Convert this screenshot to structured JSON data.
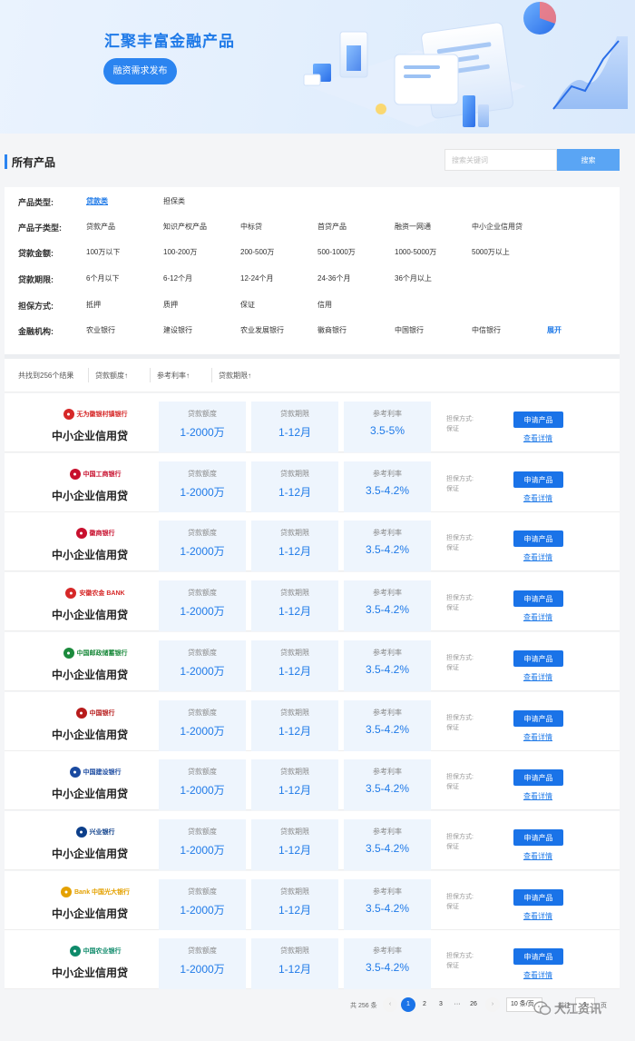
{
  "banner": {
    "title": "汇聚丰富金融产品",
    "button_label": "融资需求发布"
  },
  "section": {
    "title": "所有产品",
    "search_placeholder": "搜索关键词",
    "search_button": "搜索"
  },
  "filters": {
    "rows": [
      {
        "label": "产品类型:",
        "options": [
          "贷款类",
          "担保类"
        ],
        "active": 0
      },
      {
        "label": "产品子类型:",
        "options": [
          "贷款产品",
          "知识产权产品",
          "中标贷",
          "首贷产品",
          "融资一网通",
          "中小企业信用贷"
        ],
        "active": -1
      },
      {
        "label": "贷款金额:",
        "options": [
          "100万以下",
          "100-200万",
          "200-500万",
          "500-1000万",
          "1000-5000万",
          "5000万以上"
        ],
        "active": -1
      },
      {
        "label": "贷款期限:",
        "options": [
          "6个月以下",
          "6-12个月",
          "12-24个月",
          "24-36个月",
          "36个月以上"
        ],
        "active": -1
      },
      {
        "label": "担保方式:",
        "options": [
          "抵押",
          "质押",
          "保证",
          "信用"
        ],
        "active": -1
      },
      {
        "label": "金融机构:",
        "options": [
          "农业银行",
          "建设银行",
          "农业发展银行",
          "徽商银行",
          "中国银行",
          "中信银行"
        ],
        "active": -1
      }
    ],
    "expand_label": "展开"
  },
  "sortbar": {
    "result_text": "共找到256个结果",
    "sorts": [
      "贷款额度↑",
      "参考利率↑",
      "贷款期限↑"
    ]
  },
  "product_labels": {
    "amount": "贷款额度",
    "term": "贷款期限",
    "rate": "参考利率",
    "guarantee_label": "担保方式:",
    "apply": "申请产品",
    "detail": "查看详情"
  },
  "products": [
    {
      "bank": "无为徽银村镇银行",
      "logo_color": "#d62828",
      "icon": "bank-logo-icon",
      "name": "中小企业信用贷",
      "amount": "1-2000万",
      "term": "1-12月",
      "rate": "3.5-5%",
      "guarantee": "保证"
    },
    {
      "bank": "中国工商银行",
      "logo_color": "#c8102e",
      "icon": "bank-logo-icon",
      "name": "中小企业信用贷",
      "amount": "1-2000万",
      "term": "1-12月",
      "rate": "3.5-4.2%",
      "guarantee": "保证"
    },
    {
      "bank": "徽商银行",
      "logo_color": "#c8102e",
      "icon": "bank-logo-icon",
      "name": "中小企业信用贷",
      "amount": "1-2000万",
      "term": "1-12月",
      "rate": "3.5-4.2%",
      "guarantee": "保证"
    },
    {
      "bank": "安徽农金 BANK",
      "logo_color": "#d62828",
      "icon": "bank-logo-icon",
      "name": "中小企业信用贷",
      "amount": "1-2000万",
      "term": "1-12月",
      "rate": "3.5-4.2%",
      "guarantee": "保证"
    },
    {
      "bank": "中国邮政储蓄银行",
      "logo_color": "#1b8a3c",
      "icon": "bank-logo-icon",
      "name": "中小企业信用贷",
      "amount": "1-2000万",
      "term": "1-12月",
      "rate": "3.5-4.2%",
      "guarantee": "保证"
    },
    {
      "bank": "中国银行",
      "logo_color": "#b71c1c",
      "icon": "bank-logo-icon",
      "name": "中小企业信用贷",
      "amount": "1-2000万",
      "term": "1-12月",
      "rate": "3.5-4.2%",
      "guarantee": "保证"
    },
    {
      "bank": "中国建设银行",
      "logo_color": "#1a4aa0",
      "icon": "bank-logo-icon",
      "name": "中小企业信用贷",
      "amount": "1-2000万",
      "term": "1-12月",
      "rate": "3.5-4.2%",
      "guarantee": "保证"
    },
    {
      "bank": "兴业银行",
      "logo_color": "#0d3f8a",
      "icon": "bank-logo-icon",
      "name": "中小企业信用贷",
      "amount": "1-2000万",
      "term": "1-12月",
      "rate": "3.5-4.2%",
      "guarantee": "保证"
    },
    {
      "bank": "Bank 中国光大银行",
      "logo_color": "#e4a100",
      "icon": "bank-logo-icon",
      "name": "中小企业信用贷",
      "amount": "1-2000万",
      "term": "1-12月",
      "rate": "3.5-4.2%",
      "guarantee": "保证"
    },
    {
      "bank": "中国农业银行",
      "logo_color": "#0e8a6a",
      "icon": "bank-logo-icon",
      "name": "中小企业信用贷",
      "amount": "1-2000万",
      "term": "1-12月",
      "rate": "3.5-4.2%",
      "guarantee": "保证"
    }
  ],
  "pager": {
    "total": "共 256 条",
    "prev": "‹",
    "pages": [
      "1",
      "2",
      "3",
      "···",
      "26"
    ],
    "next": "›",
    "size": "10 条/页",
    "goto": "前往",
    "current": "1",
    "unit": "页"
  },
  "watermark": "大江资讯"
}
